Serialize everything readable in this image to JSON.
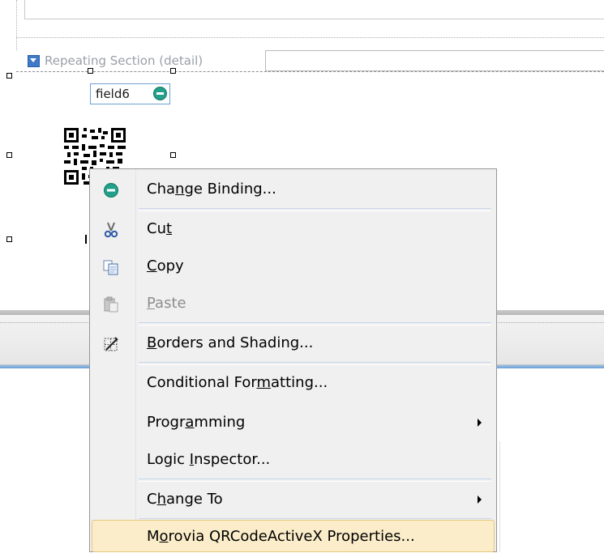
{
  "canvas": {
    "repeating_section_label": "Repeating Section (detail)",
    "field_label": "field6"
  },
  "context_menu": {
    "items": [
      {
        "label": "Change Binding...",
        "underline": "n",
        "icon": "binding-icon",
        "enabled": true
      },
      {
        "label": "Cut",
        "underline": "t",
        "icon": "scissors-icon",
        "enabled": true
      },
      {
        "label": "Copy",
        "underline": "C",
        "icon": "copy-icon",
        "enabled": true
      },
      {
        "label": "Paste",
        "underline": "P",
        "icon": "paste-icon",
        "enabled": false
      },
      {
        "label": "Borders and Shading...",
        "underline": "B",
        "icon": "borders-icon",
        "enabled": true
      },
      {
        "label": "Conditional Formatting...",
        "underline": "m",
        "enabled": true
      },
      {
        "label": "Programming",
        "underline": "a",
        "enabled": true,
        "submenu": true
      },
      {
        "label": "Logic Inspector...",
        "underline": "I",
        "enabled": true
      },
      {
        "label": "Change To",
        "underline": "h",
        "enabled": true,
        "submenu": true
      },
      {
        "label": "Morovia QRCodeActiveX Properties...",
        "underline": "o",
        "enabled": true,
        "highlighted": true
      }
    ]
  },
  "colors": {
    "menu_background": "#f0f0f0",
    "highlight_background": "#fbedc9",
    "highlight_border": "#e6c77a",
    "binding_green": "#24a08a",
    "accent_blue": "#3f79c8"
  }
}
